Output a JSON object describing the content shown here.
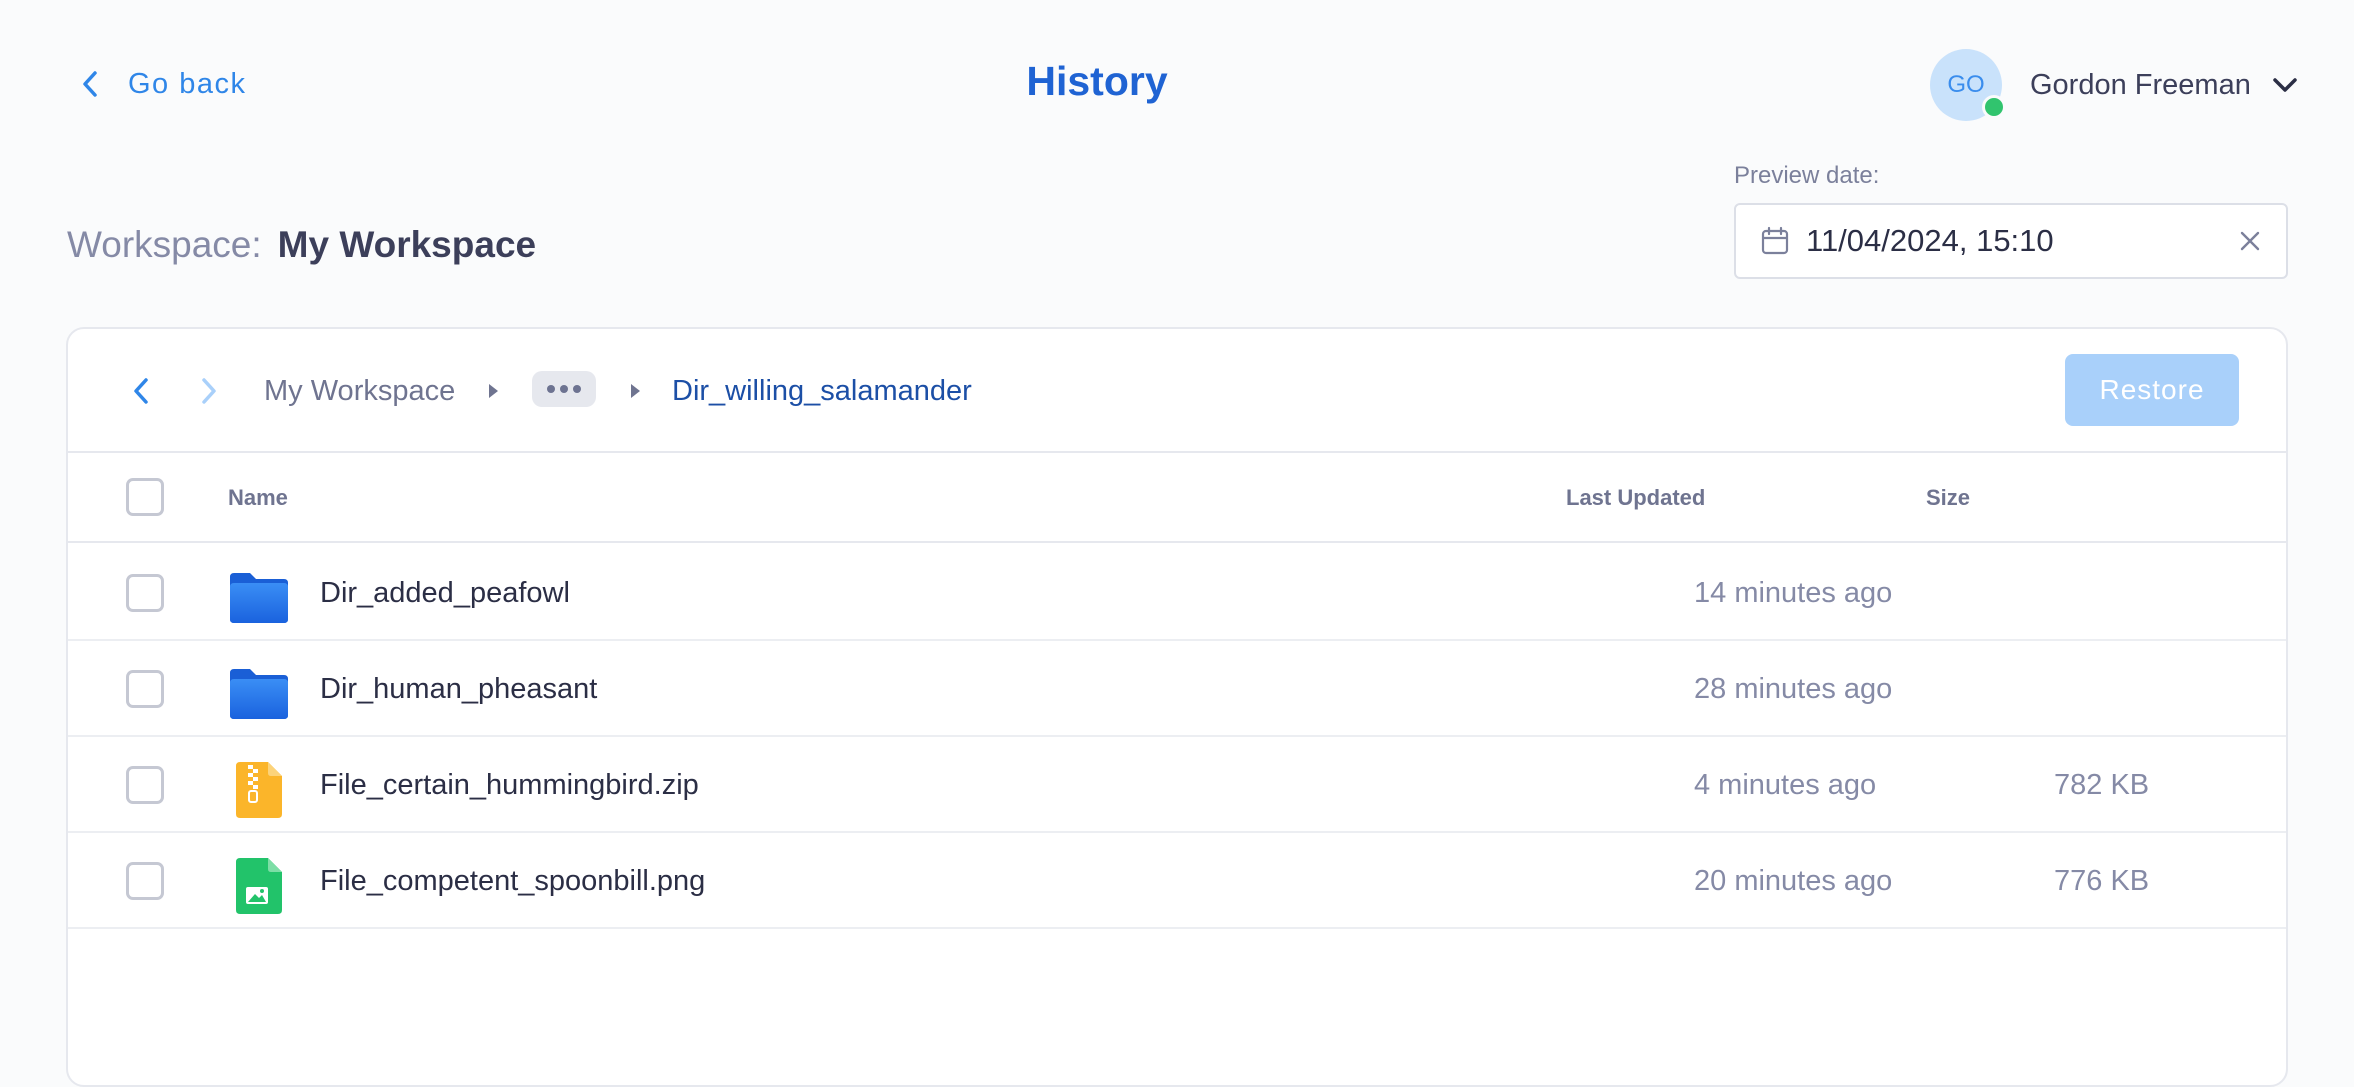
{
  "header": {
    "back_label": "Go back",
    "title": "History",
    "user": {
      "initials": "GO",
      "name": "Gordon Freeman",
      "online": true
    }
  },
  "workspace": {
    "prefix": "Workspace:",
    "name": "My Workspace"
  },
  "preview": {
    "label": "Preview date:",
    "value": "11/04/2024, 15:10"
  },
  "breadcrumb": {
    "root": "My Workspace",
    "collapsed": "...",
    "current": "Dir_willing_salamander"
  },
  "actions": {
    "restore_label": "Restore"
  },
  "table": {
    "columns": {
      "name": "Name",
      "last_updated": "Last Updated",
      "size": "Size"
    },
    "rows": [
      {
        "type": "folder",
        "name": "Dir_added_peafowl",
        "updated": "14 minutes ago",
        "size": ""
      },
      {
        "type": "folder",
        "name": "Dir_human_pheasant",
        "updated": "28 minutes ago",
        "size": ""
      },
      {
        "type": "zip",
        "name": "File_certain_hummingbird.zip",
        "updated": "4 minutes ago",
        "size": "782 KB"
      },
      {
        "type": "image",
        "name": "File_competent_spoonbill.png",
        "updated": "20 minutes ago",
        "size": "776 KB"
      }
    ]
  },
  "colors": {
    "accent": "#1f63d3",
    "link": "#2f86e8",
    "restore_disabled": "#a9d0fa",
    "folder": "#2a79ea",
    "zip": "#fbb52a",
    "image": "#22c36a",
    "online": "#31c46e"
  },
  "icons": {
    "back": "chevron-left-icon",
    "user_menu": "chevron-down-icon",
    "calendar": "calendar-icon",
    "clear": "close-icon",
    "nav_back": "chevron-left-icon",
    "nav_forward": "chevron-right-icon",
    "folder": "folder-icon",
    "zip": "zip-file-icon",
    "image": "image-file-icon"
  }
}
